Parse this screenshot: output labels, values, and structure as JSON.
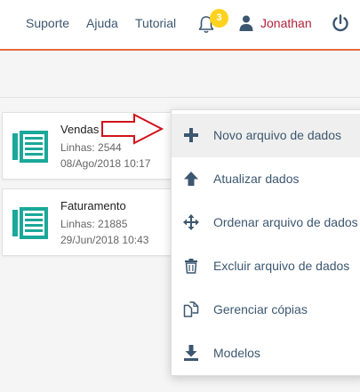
{
  "colors": {
    "accent": "#e8673c",
    "user": "#b3223a",
    "link": "#3c5770",
    "file_icon": "#1aa89a",
    "badge": "#ffd21f",
    "arrow": "#d0121b"
  },
  "header": {
    "links": [
      "Suporte",
      "Ajuda",
      "Tutorial"
    ],
    "notifications": {
      "icon": "bell-icon",
      "count": "3"
    },
    "user": {
      "icon": "user-icon",
      "name": "Jonathan"
    },
    "logout_icon": "power-icon"
  },
  "files": [
    {
      "name": "Vendas",
      "lines": "Linhas: 2544",
      "date": "08/Ago/2018 10:17"
    },
    {
      "name": "Faturamento",
      "lines": "Linhas: 21885",
      "date": "29/Jun/2018 10:43"
    }
  ],
  "context_menu": {
    "items": [
      {
        "label": "Novo arquivo de dados",
        "icon": "plus-icon"
      },
      {
        "label": "Atualizar dados",
        "icon": "arrow-up-icon"
      },
      {
        "label": "Ordenar arquivo de dados",
        "icon": "move-icon"
      },
      {
        "label": "Excluir arquivo de dados",
        "icon": "trash-icon"
      },
      {
        "label": "Gerenciar cópias",
        "icon": "copy-icon"
      },
      {
        "label": "Modelos",
        "icon": "download-icon"
      }
    ]
  }
}
